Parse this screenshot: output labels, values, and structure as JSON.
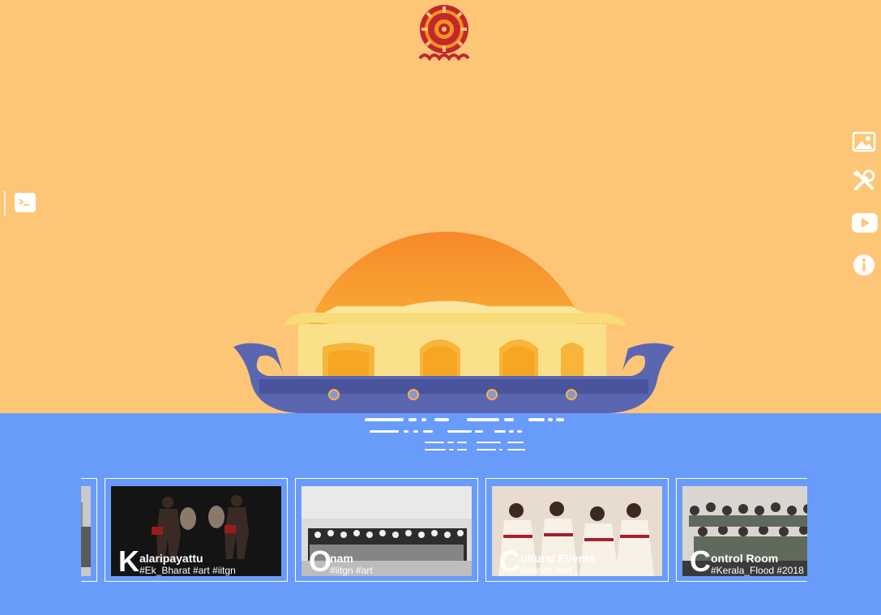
{
  "logo": {
    "icon": "samagam-logo-icon",
    "colors": {
      "primary": "#c1272d",
      "accent": "#f7931e"
    }
  },
  "side_nav": [
    {
      "name": "gallery",
      "icon": "image-icon"
    },
    {
      "name": "tools",
      "icon": "tools-icon"
    },
    {
      "name": "youtube",
      "icon": "youtube-icon"
    },
    {
      "name": "info",
      "icon": "info-icon"
    }
  ],
  "terminal": {
    "icon": "terminal-icon"
  },
  "colors": {
    "sky": "#fdc676",
    "water": "#699cfa",
    "sun": "#f7941d",
    "boat_hull": "#5b66b0",
    "boat_roof": "#f9dc7a"
  },
  "cards": [
    {
      "letter": "K",
      "title": "alaripayattu",
      "tags": "#Ek_Bharat #art #iitgn"
    },
    {
      "letter": "O",
      "title": "nam",
      "tags": "#iitgn #art"
    },
    {
      "letter": "C",
      "title": "ultural Events",
      "tags": "#dance #art"
    },
    {
      "letter": "C",
      "title": "ontrol Room",
      "tags": "#Kerala_Flood #2018"
    }
  ]
}
